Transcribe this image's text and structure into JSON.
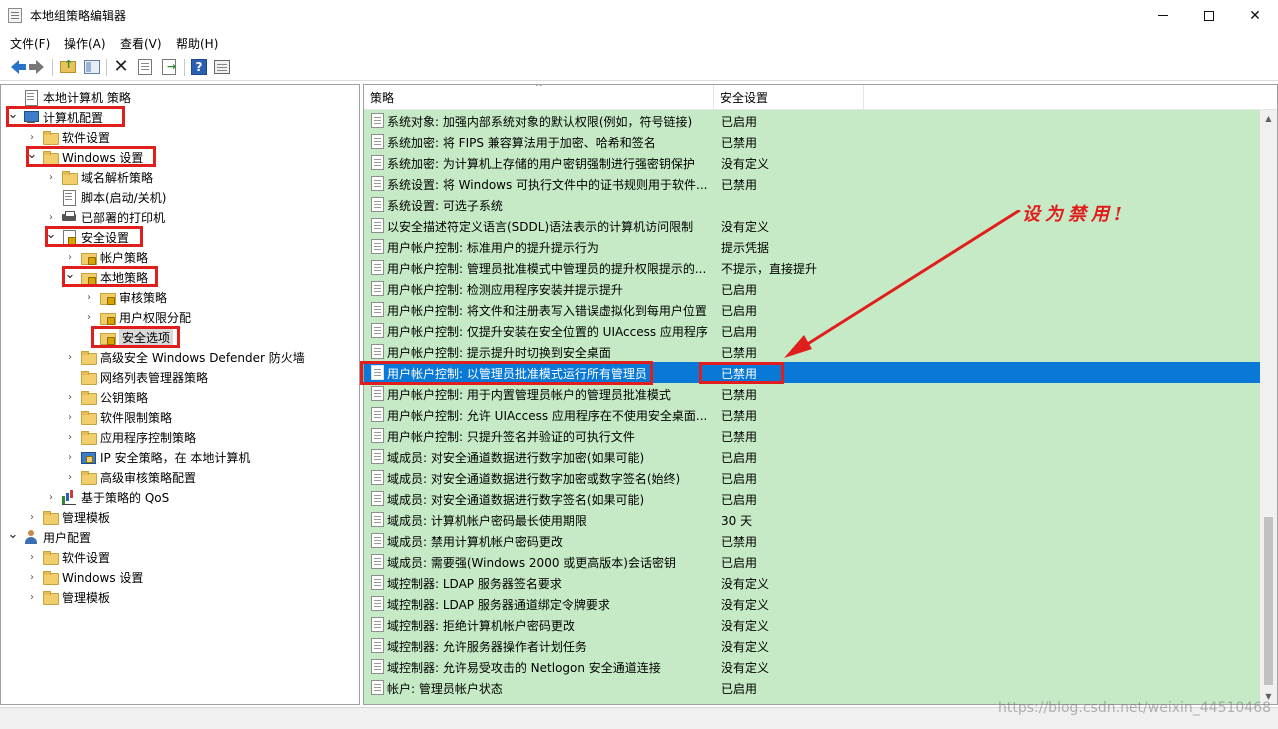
{
  "window": {
    "title": "本地组策略编辑器",
    "controls": {
      "minimize": "minimize-icon",
      "maximize": "maximize-icon",
      "close": "close-icon"
    }
  },
  "menu": [
    {
      "label": "文件(F)"
    },
    {
      "label": "操作(A)"
    },
    {
      "label": "查看(V)"
    },
    {
      "label": "帮助(H)"
    }
  ],
  "toolbar": {
    "icons": [
      "back-icon",
      "forward-icon",
      "up-folder-icon",
      "show-tree-icon",
      "delete-icon",
      "properties-icon",
      "export-icon",
      "help-icon",
      "view-icon"
    ]
  },
  "tree": [
    {
      "label": "本地计算机 策略",
      "level": 0,
      "icon": "doc",
      "expander": "none"
    },
    {
      "label": "计算机配置",
      "level": 0,
      "icon": "computer",
      "expander": "open",
      "highlight": true
    },
    {
      "label": "软件设置",
      "level": 1,
      "icon": "folder",
      "expander": "closed"
    },
    {
      "label": "Windows 设置",
      "level": 1,
      "icon": "folder",
      "expander": "open",
      "highlight": true
    },
    {
      "label": "域名解析策略",
      "level": 2,
      "icon": "folder",
      "expander": "closed"
    },
    {
      "label": "脚本(启动/关机)",
      "level": 2,
      "icon": "doc",
      "expander": "none"
    },
    {
      "label": "已部署的打印机",
      "level": 2,
      "icon": "printer",
      "expander": "closed"
    },
    {
      "label": "安全设置",
      "level": 2,
      "icon": "secdoc",
      "expander": "open",
      "highlight": true
    },
    {
      "label": "帐户策略",
      "level": 3,
      "icon": "folder-lock",
      "expander": "closed"
    },
    {
      "label": "本地策略",
      "level": 3,
      "icon": "folder-lock",
      "expander": "open",
      "highlight": true
    },
    {
      "label": "审核策略",
      "level": 4,
      "icon": "folder-lock",
      "expander": "closed"
    },
    {
      "label": "用户权限分配",
      "level": 4,
      "icon": "folder-lock",
      "expander": "closed"
    },
    {
      "label": "安全选项",
      "level": 4,
      "icon": "folder-lock",
      "expander": "none",
      "selected": true,
      "highlight": true
    },
    {
      "label": "高级安全 Windows Defender 防火墙",
      "level": 3,
      "icon": "folder",
      "expander": "closed"
    },
    {
      "label": "网络列表管理器策略",
      "level": 3,
      "icon": "folder",
      "expander": "none"
    },
    {
      "label": "公钥策略",
      "level": 3,
      "icon": "folder",
      "expander": "closed"
    },
    {
      "label": "软件限制策略",
      "level": 3,
      "icon": "folder",
      "expander": "closed"
    },
    {
      "label": "应用程序控制策略",
      "level": 3,
      "icon": "folder",
      "expander": "closed"
    },
    {
      "label": "IP 安全策略，在 本地计算机",
      "level": 3,
      "icon": "ipsec",
      "expander": "closed"
    },
    {
      "label": "高级审核策略配置",
      "level": 3,
      "icon": "folder",
      "expander": "closed"
    },
    {
      "label": "基于策略的 QoS",
      "level": 2,
      "icon": "chart",
      "expander": "closed"
    },
    {
      "label": "管理模板",
      "level": 1,
      "icon": "folder",
      "expander": "closed"
    },
    {
      "label": "用户配置",
      "level": 0,
      "icon": "user",
      "expander": "open"
    },
    {
      "label": "软件设置",
      "level": 1,
      "icon": "folder",
      "expander": "closed"
    },
    {
      "label": "Windows 设置",
      "level": 1,
      "icon": "folder",
      "expander": "closed"
    },
    {
      "label": "管理模板",
      "level": 1,
      "icon": "folder",
      "expander": "closed"
    }
  ],
  "list": {
    "columns": {
      "policy": "策略",
      "setting": "安全设置"
    },
    "rows": [
      {
        "policy": "系统对象: 加强内部系统对象的默认权限(例如，符号链接)",
        "setting": "已启用"
      },
      {
        "policy": "系统加密: 将 FIPS 兼容算法用于加密、哈希和签名",
        "setting": "已禁用"
      },
      {
        "policy": "系统加密: 为计算机上存储的用户密钥强制进行强密钥保护",
        "setting": "没有定义"
      },
      {
        "policy": "系统设置: 将 Windows 可执行文件中的证书规则用于软件...",
        "setting": "已禁用"
      },
      {
        "policy": "系统设置: 可选子系统",
        "setting": ""
      },
      {
        "policy": "以安全描述符定义语言(SDDL)语法表示的计算机访问限制",
        "setting": "没有定义"
      },
      {
        "policy": "用户帐户控制: 标准用户的提升提示行为",
        "setting": "提示凭据"
      },
      {
        "policy": "用户帐户控制: 管理员批准模式中管理员的提升权限提示的...",
        "setting": "不提示，直接提升"
      },
      {
        "policy": "用户帐户控制: 检测应用程序安装并提示提升",
        "setting": "已启用"
      },
      {
        "policy": "用户帐户控制: 将文件和注册表写入错误虚拟化到每用户位置",
        "setting": "已启用"
      },
      {
        "policy": "用户帐户控制: 仅提升安装在安全位置的 UIAccess 应用程序",
        "setting": "已启用"
      },
      {
        "policy": "用户帐户控制: 提示提升时切换到安全桌面",
        "setting": "已禁用"
      },
      {
        "policy": "用户帐户控制: 以管理员批准模式运行所有管理员",
        "setting": "已禁用",
        "selected": true,
        "highlight": true
      },
      {
        "policy": "用户帐户控制: 用于内置管理员帐户的管理员批准模式",
        "setting": "已禁用"
      },
      {
        "policy": "用户帐户控制: 允许 UIAccess 应用程序在不使用安全桌面...",
        "setting": "已禁用"
      },
      {
        "policy": "用户帐户控制: 只提升签名并验证的可执行文件",
        "setting": "已禁用"
      },
      {
        "policy": "域成员: 对安全通道数据进行数字加密(如果可能)",
        "setting": "已启用"
      },
      {
        "policy": "域成员: 对安全通道数据进行数字加密或数字签名(始终)",
        "setting": "已启用"
      },
      {
        "policy": "域成员: 对安全通道数据进行数字签名(如果可能)",
        "setting": "已启用"
      },
      {
        "policy": "域成员: 计算机帐户密码最长使用期限",
        "setting": "30 天"
      },
      {
        "policy": "域成员: 禁用计算机帐户密码更改",
        "setting": "已禁用"
      },
      {
        "policy": "域成员: 需要强(Windows 2000 或更高版本)会话密钥",
        "setting": "已启用"
      },
      {
        "policy": "域控制器: LDAP 服务器签名要求",
        "setting": "没有定义"
      },
      {
        "policy": "域控制器: LDAP 服务器通道绑定令牌要求",
        "setting": "没有定义"
      },
      {
        "policy": "域控制器: 拒绝计算机帐户密码更改",
        "setting": "没有定义"
      },
      {
        "policy": "域控制器: 允许服务器操作者计划任务",
        "setting": "没有定义"
      },
      {
        "policy": "域控制器: 允许易受攻击的 Netlogon 安全通道连接",
        "setting": "没有定义"
      },
      {
        "policy": "帐户: 管理员帐户状态",
        "setting": "已启用"
      }
    ]
  },
  "annotation": {
    "text": "设为禁用!",
    "color": "#e01e1e"
  },
  "watermark": "https://blog.csdn.net/weixin_44510468",
  "colors": {
    "list_bg": "#c6eac6",
    "selection": "#0a78d7",
    "highlight_box": "#e01e1e"
  }
}
